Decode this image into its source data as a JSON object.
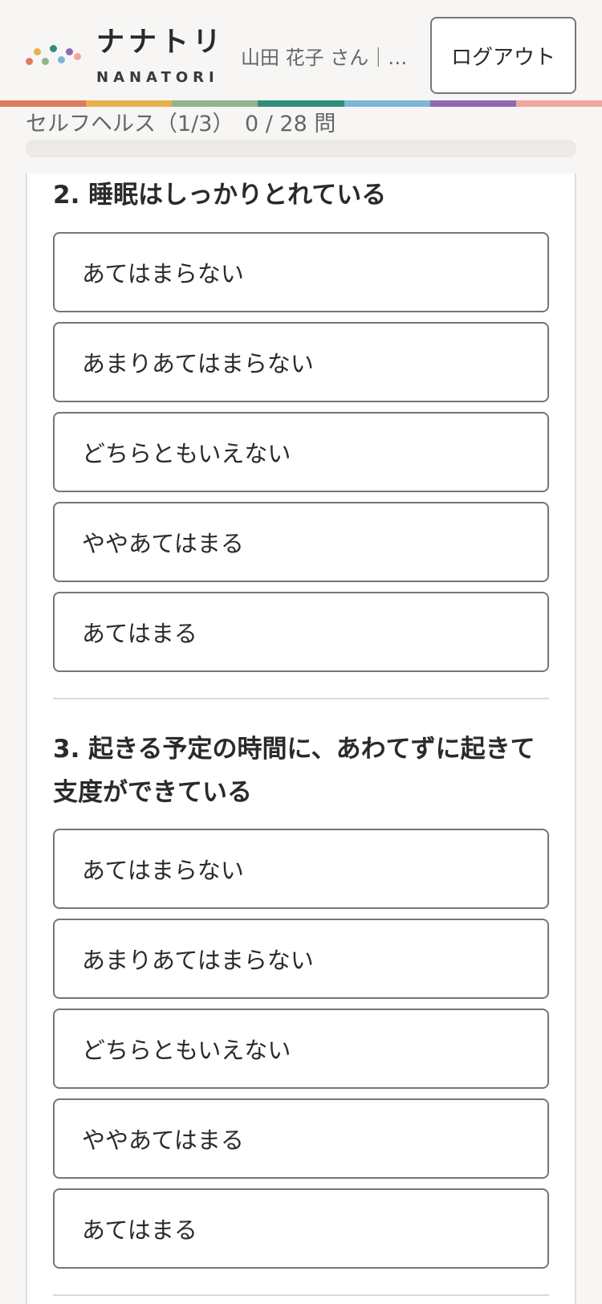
{
  "brand": {
    "name": "ナナトリ",
    "sub": "NANATORI"
  },
  "user": {
    "name": "山田 花子 さん｜…"
  },
  "header": {
    "logout_label": "ログアウト"
  },
  "progress": {
    "label": "セルフヘルス（1/3）　0 / 28 問",
    "answered": 0,
    "total": 28
  },
  "colors": {
    "bar": [
      "#e07a5f",
      "#e6b04a",
      "#8fb58e",
      "#2f8f7a",
      "#7bb6d6",
      "#8e6ab0",
      "#f2a69e"
    ],
    "dots": [
      "#e07a5f",
      "#e6b04a",
      "#8fb58e",
      "#2f8f7a",
      "#7bb6d6",
      "#8e6ab0",
      "#f2a69e"
    ]
  },
  "questions": [
    {
      "title": "2. 睡眠はしっかりとれている",
      "options": [
        "あてはまらない",
        "あまりあてはまらない",
        "どちらともいえない",
        "ややあてはまる",
        "あてはまる"
      ]
    },
    {
      "title": "3. 起きる予定の時間に、あわてずに起きて支度ができている",
      "options": [
        "あてはまらない",
        "あまりあてはまらない",
        "どちらともいえない",
        "ややあてはまる",
        "あてはまる"
      ]
    }
  ]
}
